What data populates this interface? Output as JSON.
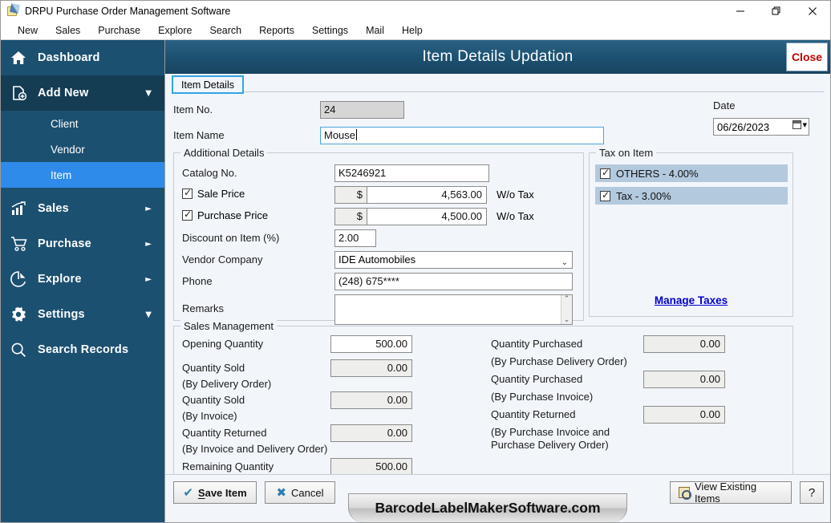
{
  "window": {
    "title": "DRPU Purchase Order Management Software",
    "icon": "app-icon",
    "controls": {
      "minimize": "—",
      "maximize": "❐",
      "close": "✕"
    }
  },
  "menubar": {
    "items": [
      "New",
      "Sales",
      "Purchase",
      "Explore",
      "Search",
      "Reports",
      "Settings",
      "Mail",
      "Help"
    ]
  },
  "sidebar": {
    "items": [
      {
        "label": "Dashboard",
        "icon": "home-icon",
        "caret": "",
        "state": "normal"
      },
      {
        "label": "Add New",
        "icon": "add-file-icon",
        "caret": "▼",
        "state": "expanded"
      },
      {
        "label": "Sales",
        "icon": "bar-chart-icon",
        "caret": "►",
        "state": "normal"
      },
      {
        "label": "Purchase",
        "icon": "shopping-cart-icon",
        "caret": "►",
        "state": "normal"
      },
      {
        "label": "Explore",
        "icon": "pie-chart-icon",
        "caret": "►",
        "state": "normal"
      },
      {
        "label": "Settings",
        "icon": "gear-icon",
        "caret": "▼",
        "state": "normal"
      },
      {
        "label": "Search Records",
        "icon": "search-icon",
        "caret": "",
        "state": "normal"
      }
    ],
    "subitems": [
      {
        "label": "Client",
        "selected": false
      },
      {
        "label": "Vendor",
        "selected": false
      },
      {
        "label": "Item",
        "selected": true
      }
    ],
    "colors": {
      "background": "#1c5070",
      "active": "#143c53",
      "selected": "#2e8bea"
    }
  },
  "panel": {
    "title": "Item Details Updation",
    "close_label": "Close",
    "close_color": "#c00000",
    "tab_label": "Item Details"
  },
  "form": {
    "item_no": {
      "label": "Item No.",
      "value": "24",
      "readonly": true
    },
    "item_name": {
      "label": "Item Name",
      "value": "Mouse",
      "focused": true
    },
    "date": {
      "label": "Date",
      "value": "06/26/2023"
    }
  },
  "additional_details": {
    "title": "Additional Details",
    "catalog_no": {
      "label": "Catalog No.",
      "value": "K5246921"
    },
    "sale_price": {
      "label": "Sale Price",
      "checked": true,
      "currency": "$",
      "value": "4,563.00",
      "suffix": "W/o Tax"
    },
    "purchase_price": {
      "label": "Purchase Price",
      "checked": true,
      "currency": "$",
      "value": "4,500.00",
      "suffix": "W/o Tax"
    },
    "discount": {
      "label": "Discount on Item (%)",
      "value": "2.00"
    },
    "vendor_company": {
      "label": "Vendor Company",
      "value": "IDE Automobiles"
    },
    "phone": {
      "label": "Phone",
      "value": "(248) 675****"
    },
    "remarks": {
      "label": "Remarks",
      "value": ""
    }
  },
  "tax_on_item": {
    "title": "Tax on Item",
    "rows": [
      {
        "label": "OTHERS - 4.00%",
        "checked": true
      },
      {
        "label": "Tax - 3.00%",
        "checked": true
      }
    ],
    "manage_link": "Manage Taxes",
    "link_color": "#0000cc"
  },
  "sales_management": {
    "title": "Sales Management",
    "left": [
      {
        "label": "Opening Quantity",
        "sublabel": "",
        "value": "500.00",
        "editable": true
      },
      {
        "label": "Quantity Sold",
        "sublabel": "(By Delivery Order)",
        "value": "0.00",
        "editable": false
      },
      {
        "label": "Quantity Sold",
        "sublabel": "(By Invoice)",
        "value": "0.00",
        "editable": false
      },
      {
        "label": "Quantity Returned",
        "sublabel": "(By Invoice and Delivery Order)",
        "value": "0.00",
        "editable": false
      },
      {
        "label": "Remaining Quantity",
        "sublabel": "",
        "value": "500.00",
        "editable": false
      }
    ],
    "right": [
      {
        "label": "Quantity Purchased",
        "sublabel": "(By Purchase Delivery Order)",
        "value": "0.00"
      },
      {
        "label": "Quantity Purchased",
        "sublabel": "(By Purchase Invoice)",
        "value": "0.00"
      },
      {
        "label": "Quantity Returned",
        "sublabel1": "(By Purchase Invoice and",
        "sublabel2": "Purchase Delivery Order)",
        "value": "0.00"
      }
    ]
  },
  "bottombar": {
    "save": "Save Item",
    "save_mnemonic": "S",
    "save_rest": "ave Item",
    "cancel": "Cancel",
    "view_existing": "View Existing Items",
    "help": "?"
  },
  "watermark": {
    "text": "BarcodeLabelMakerSoftware.com"
  }
}
